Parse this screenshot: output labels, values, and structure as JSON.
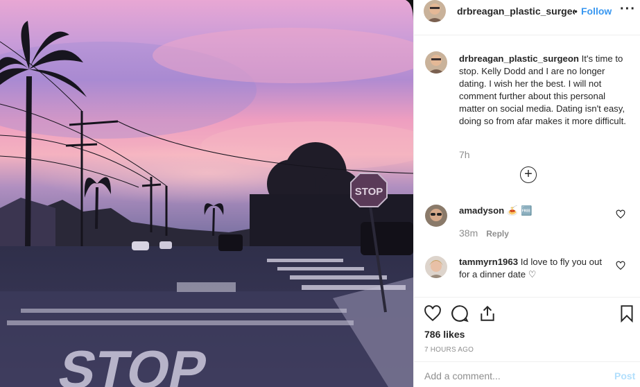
{
  "post": {
    "username": "drbreagan_plastic_surgeon",
    "header_username": "drbreagan_plastic_surgeoı",
    "separator": "•",
    "follow_label": "Follow",
    "more_icon": "more-options-icon",
    "more_text": "···",
    "caption": {
      "username": "drbreagan_plastic_surgeon",
      "text": "It's time to stop. Kelly Dodd and I are no longer dating. I wish her the best. I will not comment further about this personal matter on social media. Dating isn't easy, doing so from afar makes it more difficult.",
      "time": "7h"
    },
    "load_more_icon": "plus-circle-icon",
    "comments": [
      {
        "username": "amadyson",
        "text": "🍝 🆓",
        "time": "38m",
        "reply_label": "Reply"
      },
      {
        "username": "tammyrn1963",
        "text": "Id love to fly you out for a dinner date ♡",
        "time": "",
        "reply_label": ""
      }
    ],
    "likes": "786 likes",
    "time_ago": "7 HOURS AGO",
    "comment_placeholder": "Add a comment...",
    "post_label": "Post",
    "photo": {
      "sign_text": "STOP",
      "road_text": "STOP"
    },
    "colors": {
      "link": "#3897f0",
      "post_disabled": "#b2dffc",
      "muted": "#8e8e8e",
      "text": "#262626"
    }
  }
}
